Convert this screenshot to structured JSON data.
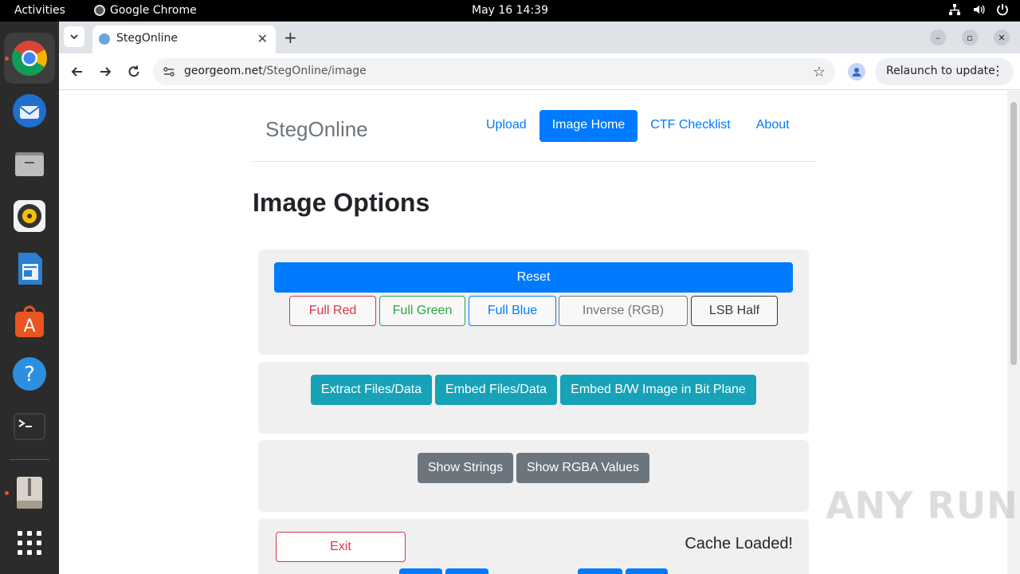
{
  "topbar": {
    "activities": "Activities",
    "app_name": "Google Chrome",
    "clock": "May 16  14:39"
  },
  "dock": {
    "items": [
      {
        "name": "chrome",
        "icon": "chrome-icon",
        "running": true
      },
      {
        "name": "thunderbird",
        "icon": "thunderbird-icon",
        "running": false
      },
      {
        "name": "files",
        "icon": "files-icon",
        "running": false
      },
      {
        "name": "rhythmbox",
        "icon": "rhythmbox-icon",
        "running": false
      },
      {
        "name": "writer",
        "icon": "writer-icon",
        "running": false
      },
      {
        "name": "app-center",
        "icon": "app-center-icon",
        "running": false
      },
      {
        "name": "help",
        "icon": "help-icon",
        "running": false
      },
      {
        "name": "terminal",
        "icon": "terminal-icon",
        "running": false
      },
      {
        "name": "archive",
        "icon": "archive-icon",
        "running": true
      },
      {
        "name": "show-apps",
        "icon": "grid-icon",
        "running": false
      }
    ]
  },
  "browser": {
    "tab_title": "StegOnline",
    "url_domain": "georgeom.net",
    "url_path": "/StegOnline/image",
    "relaunch_label": "Relaunch to update"
  },
  "page": {
    "brand": "StegOnline",
    "nav": {
      "upload": "Upload",
      "image_home": "Image Home",
      "ctf_checklist": "CTF Checklist",
      "about": "About"
    },
    "heading": "Image Options",
    "buttons": {
      "reset": "Reset",
      "full_red": "Full Red",
      "full_green": "Full Green",
      "full_blue": "Full Blue",
      "inverse": "Inverse (RGB)",
      "lsb_half": "LSB Half",
      "extract": "Extract Files/Data",
      "embed": "Embed Files/Data",
      "embed_bw": "Embed B/W Image in Bit Plane",
      "show_strings": "Show Strings",
      "show_rgba": "Show RGBA Values",
      "exit": "Exit"
    },
    "cache_status": "Cache Loaded!"
  },
  "watermark": "ANY RUN",
  "colors": {
    "primary": "#007bff",
    "danger": "#dc3545",
    "success": "#28a745",
    "info": "#17a2b8",
    "secondary": "#6c757d"
  }
}
